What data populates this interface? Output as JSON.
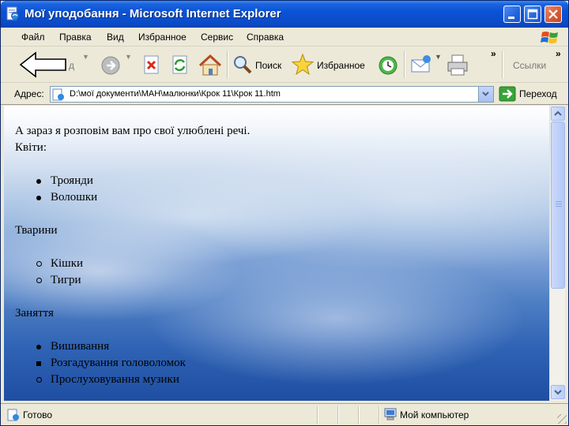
{
  "window": {
    "title": "Мої уподобання - Microsoft Internet Explorer"
  },
  "menu": [
    {
      "label": "Файл"
    },
    {
      "label": "Правка"
    },
    {
      "label": "Вид"
    },
    {
      "label": "Избранное"
    },
    {
      "label": "Сервис"
    },
    {
      "label": "Справка"
    }
  ],
  "toolbar": {
    "back_label": "Назад",
    "back_visible_suffix": "д",
    "search_label": "Поиск",
    "favorites_label": "Избранное",
    "overflow_chevron": "»",
    "links_label": "Ссылки",
    "links_chevron": "»"
  },
  "address": {
    "label": "Адрес:",
    "value": "D:\\мої документи\\МАН\\малюнки\\Крок 11\\Крок 11.htm",
    "go_label": "Переход"
  },
  "page": {
    "intro": "А зараз я розповім вам про свої улюблені речі.",
    "section1_title": "Квіти:",
    "flowers": [
      "Троянди",
      "Волошки"
    ],
    "section2_title": "Тварини",
    "animals": [
      "Кішки",
      "Тигри"
    ],
    "section3_title": "Заняття",
    "hobbies": [
      "Вишивання",
      "Розгадування головоломок",
      "Прослуховування музики"
    ]
  },
  "status": {
    "text": "Готово",
    "zone": "Мой компьютер"
  },
  "colors": {
    "titlebar": "#0a53d6",
    "chrome": "#ece9d8",
    "sky_top": "#ffffff",
    "sky_bottom": "#1f4ea2"
  }
}
